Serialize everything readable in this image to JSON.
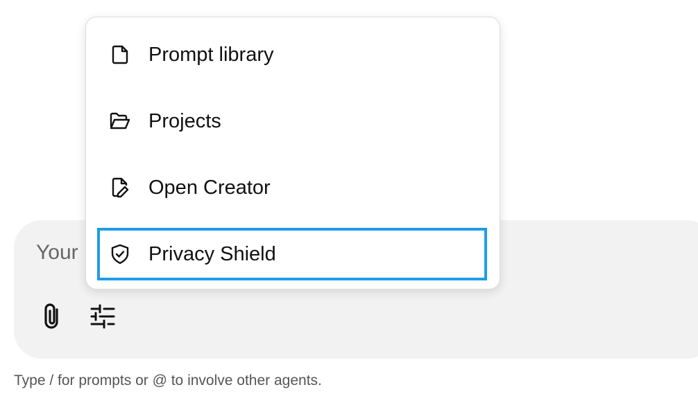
{
  "composer": {
    "placeholder": "Your",
    "attach_icon": "paperclip-icon",
    "settings_icon": "sliders-icon"
  },
  "hint": "Type / for prompts or @ to involve other agents.",
  "menu": {
    "items": [
      {
        "label": "Prompt library",
        "icon": "document-icon"
      },
      {
        "label": "Projects",
        "icon": "folder-open-icon"
      },
      {
        "label": "Open Creator",
        "icon": "file-edit-icon"
      },
      {
        "label": "Privacy Shield",
        "icon": "shield-check-icon",
        "focused": true
      }
    ]
  },
  "colors": {
    "focus_outline": "#1e9ce8",
    "composer_bg": "#f2f2f2"
  }
}
